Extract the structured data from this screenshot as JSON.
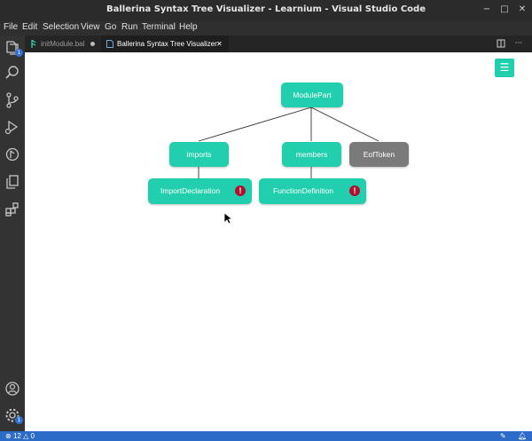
{
  "window": {
    "title": "Ballerina Syntax Tree Visualizer - Learnium - Visual Studio Code",
    "controls": {
      "minimize": "−",
      "maximize": "□",
      "close": "✕"
    }
  },
  "menu": [
    "File",
    "Edit",
    "Selection",
    "View",
    "Go",
    "Run",
    "Terminal",
    "Help"
  ],
  "activity_bar": {
    "items": [
      "explorer-icon",
      "search-icon",
      "source-control-icon",
      "run-debug-icon",
      "ballerina-icon",
      "copy-icon",
      "extensions-icon"
    ],
    "explorer_badge": "1",
    "settings_badge": "1",
    "bottom": [
      "account-icon",
      "settings-gear-icon"
    ]
  },
  "tabs": [
    {
      "label": "initModule.bal",
      "dirty": true,
      "active": false
    },
    {
      "label": "Ballerina Syntax Tree Visualizer",
      "close": "✕",
      "active": true
    }
  ],
  "tree": {
    "menu_icon": "☰",
    "nodes": {
      "root": {
        "label": "ModulePart",
        "color": "#21cfae"
      },
      "imports": {
        "label": "imports",
        "color": "#21cfae"
      },
      "members": {
        "label": "members",
        "color": "#21cfae"
      },
      "eof": {
        "label": "EofToken",
        "color": "#7a7a7a"
      },
      "import_decl": {
        "label": "ImportDeclaration",
        "color": "#21cfae",
        "warning": "!"
      },
      "function_def": {
        "label": "FunctionDefinition",
        "color": "#21cfae",
        "warning": "!"
      }
    },
    "edges": [
      [
        "root",
        "imports"
      ],
      [
        "root",
        "members"
      ],
      [
        "root",
        "eof"
      ],
      [
        "imports",
        "import_decl"
      ],
      [
        "members",
        "function_def"
      ]
    ],
    "warning_color": "#b0102f"
  },
  "status_bar": {
    "errors": "12",
    "warnings": "0"
  }
}
